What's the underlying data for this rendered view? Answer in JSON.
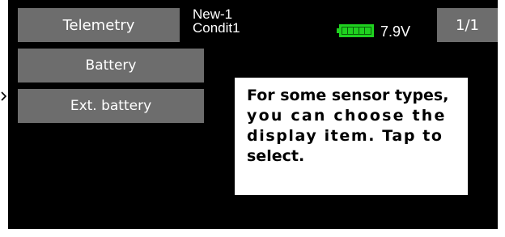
{
  "header": {
    "title": "Telemetry",
    "model_name": "New-1",
    "condition": "Condit1",
    "voltage": "7.9V",
    "page": "1/1"
  },
  "menu": {
    "items": [
      {
        "label": "Battery"
      },
      {
        "label": "Ext. battery"
      }
    ]
  },
  "callout": {
    "lines": [
      "For some sensor types,",
      "you can choose the",
      "display item. Tap to",
      "select."
    ]
  },
  "colors": {
    "background": "#000000",
    "button": "#6d6d6d",
    "battery": "#1fd11f"
  },
  "icons": {
    "battery": "battery-icon",
    "pointer": "arrow-right-icon"
  }
}
